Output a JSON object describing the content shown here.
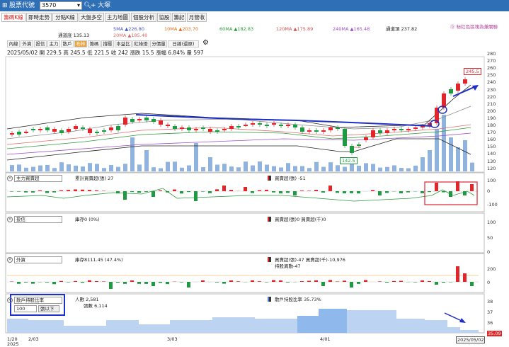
{
  "window": {
    "title": "股票代號",
    "code": "3570",
    "stock_name": "大塚"
  },
  "tabs": [
    "籌碼K線",
    "即時走勢",
    "分點K線",
    "大盤多空",
    "主力地圖",
    "個股分析",
    "協股",
    "籌記",
    "月營收"
  ],
  "hint": "⓪ 标红色區塊為兼關聯",
  "ma": {
    "m5": "5MA ▲226.80",
    "m10": "10MA ▲203.70",
    "m60": "60MA ▲182.83",
    "m120": "120MA ▲175.89",
    "m240": "240MA ▲165.48",
    "upper": "通道頂 237.82",
    "lower": "通道底 135.13",
    "m20": "20MA ▲185.48"
  },
  "toolbar": [
    "內線",
    "外資",
    "投信",
    "主力",
    "散戶",
    "布林",
    "籌碼",
    "撐壓",
    "本益比",
    "紅綠燈",
    "分價量",
    "日線(還原)"
  ],
  "ohlc": "2025/05/02 開 229.5 高 245.5 低 221.5 收 242 漲跌 15.5 漲幅 6.84% 量 597",
  "price_axis": [
    "280",
    "270",
    "260",
    "250",
    "240",
    "230",
    "220",
    "210",
    "200",
    "190",
    "180",
    "170",
    "160",
    "150",
    "140",
    "130",
    "120"
  ],
  "price_high_label": "245.5",
  "price_low_label": "142.5",
  "panels": {
    "main": {
      "select": "主力買賣超",
      "l1": "累計買賣超(張) 27",
      "l2": "買賣超(張) -51",
      "axis": [
        "100",
        "0",
        "-100"
      ]
    },
    "trust": {
      "select": "投信",
      "l1": "庫存0 (0%)",
      "l2": "買賣超(張)0 買賣超(千)0",
      "axis": [
        "100",
        "50",
        "0"
      ]
    },
    "foreign": {
      "select": "外資",
      "l1": "庫存8111.45 (47.4%)",
      "l2": "買賣超(張)-47 買賣超(千)-10,976",
      "l3": "持股異動-47",
      "axis": [
        "200",
        "0"
      ]
    },
    "holders": {
      "select": "散戶持股比率",
      "qty": "100",
      "qty_op": "張以下",
      "l1": "人數 2,581",
      "l2": "張數 6,114",
      "l3": "散戶持股比率 35.73%",
      "axis": [
        "38",
        "37",
        "36",
        "35"
      ],
      "last_value": "35.09"
    }
  },
  "xaxis": {
    "d1": "1/20",
    "d1b": "2025",
    "d2": "2/03",
    "d3": "3/03",
    "d4": "4/01",
    "d5": "2025/05/02"
  },
  "colors": {
    "up": "#e0262b",
    "down": "#1f9a43",
    "vol": "#8fb3dc",
    "trend": "#1f2fc6"
  }
}
